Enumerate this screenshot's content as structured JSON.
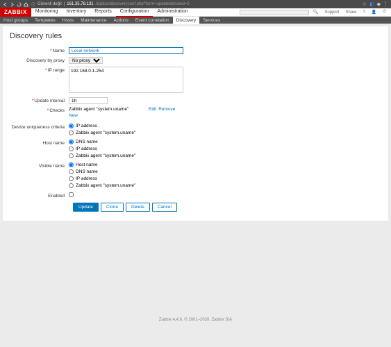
{
  "browser": {
    "secure": "Güvenli değil",
    "ip": "161.35.78.131",
    "path": "/zabbix/discoveryconf.php?form=update&druleid=2"
  },
  "logo": "ZABBIX",
  "mainNav": [
    "Monitoring",
    "Inventory",
    "Reports",
    "Configuration",
    "Administration"
  ],
  "headerRight": {
    "support": "Support",
    "share": "Share"
  },
  "subNav": [
    "Host groups",
    "Templates",
    "Hosts",
    "Maintenance",
    "Actions",
    "Event correlation",
    "Discovery",
    "Services"
  ],
  "title": "Discovery rules",
  "labels": {
    "name": "Name",
    "proxy": "Discovery by proxy",
    "iprange": "IP range",
    "interval": "Update interval",
    "checks": "Checks",
    "criteria": "Device uniqueness criteria",
    "hostname": "Host name",
    "visible": "Visible name",
    "enabled": "Enabled"
  },
  "values": {
    "name": "Local network",
    "proxy": "No proxy",
    "iprange": "192.168.0.1-254",
    "interval": "1h"
  },
  "checks": {
    "item": "Zabbix agent \"system.uname\"",
    "edit": "Edit",
    "remove": "Remove",
    "new": "New"
  },
  "radioOptions": {
    "ip": "IP address",
    "agent": "Zabbix agent \"system.uname\"",
    "dns": "DNS name",
    "host": "Host name"
  },
  "buttons": {
    "update": "Update",
    "clone": "Clone",
    "delete": "Delete",
    "cancel": "Cancel"
  },
  "footer": "Zabbix 4.4.6. © 2001–2020, Zabbix SIA"
}
